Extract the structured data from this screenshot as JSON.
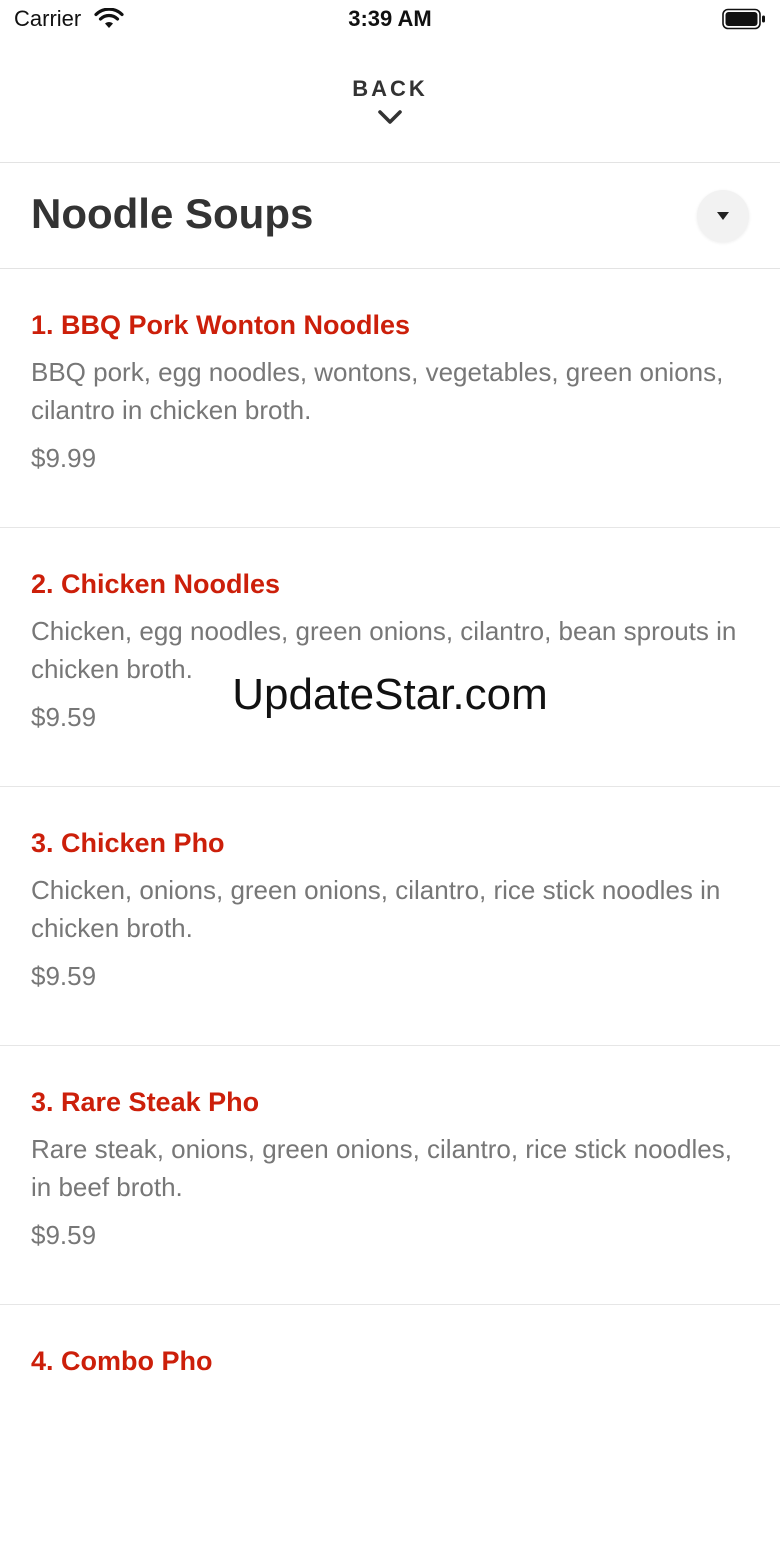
{
  "status_bar": {
    "carrier": "Carrier",
    "time": "3:39 AM",
    "icons": [
      "wifi-icon",
      "battery-icon"
    ]
  },
  "header": {
    "back_label": "BACK",
    "back_icon": "chevron-down-icon"
  },
  "section": {
    "title": "Noodle Soups",
    "toggle_icon": "caret-down-icon"
  },
  "items": [
    {
      "name": "1. BBQ Pork Wonton Noodles",
      "description": "BBQ pork, egg noodles, wontons, vegetables, green onions, cilantro in chicken broth.",
      "price": "$9.99"
    },
    {
      "name": "2. Chicken Noodles",
      "description": "Chicken, egg noodles, green onions, cilantro, bean sprouts in chicken broth.",
      "price": "$9.59"
    },
    {
      "name": "3. Chicken Pho",
      "description": "Chicken, onions, green onions, cilantro, rice stick noodles in chicken broth.",
      "price": "$9.59"
    },
    {
      "name": "3. Rare Steak Pho",
      "description": "Rare steak, onions, green onions, cilantro, rice stick noodles, in beef broth.",
      "price": "$9.59"
    },
    {
      "name": "4. Combo Pho",
      "description": "",
      "price": ""
    }
  ],
  "watermark": "UpdateStar.com",
  "colors": {
    "item_name": "#cc1f0a",
    "text_secondary": "#777777",
    "title": "#333333",
    "divider": "#e3e3e3"
  }
}
